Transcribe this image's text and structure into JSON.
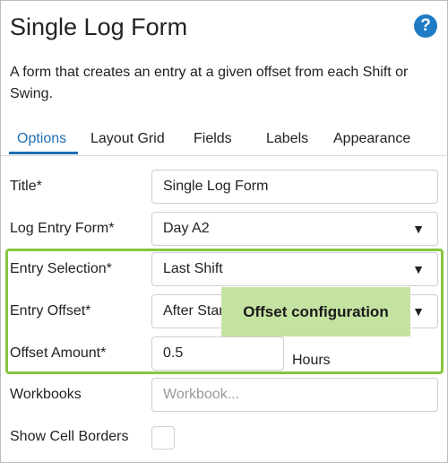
{
  "header": {
    "title": "Single Log Form",
    "help_icon": "?",
    "description": "A form that creates an entry at a given offset from each Shift or Swing."
  },
  "tabs": [
    {
      "label": "Options",
      "active": true
    },
    {
      "label": "Layout Grid",
      "active": false
    },
    {
      "label": "Fields",
      "active": false
    },
    {
      "label": "Labels",
      "active": false
    },
    {
      "label": "Appearance",
      "active": false
    }
  ],
  "form": {
    "title": {
      "label": "Title*",
      "value": "Single Log Form"
    },
    "log_entry_form": {
      "label": "Log Entry Form*",
      "value": "Day A2"
    },
    "entry_selection": {
      "label": "Entry Selection*",
      "value": "Last Shift"
    },
    "entry_offset": {
      "label": "Entry Offset*",
      "value": "After Start"
    },
    "offset_amount": {
      "label": "Offset Amount*",
      "value": "0.5",
      "unit": "Hours"
    },
    "workbooks": {
      "label": "Workbooks",
      "placeholder": "Workbook..."
    },
    "show_cell_borders": {
      "label": "Show Cell Borders",
      "checked": false
    }
  },
  "callout": {
    "text": "Offset configuration"
  },
  "icons": {
    "dropdown_caret": "▼"
  },
  "colors": {
    "accent_blue": "#1e6fb5",
    "help_blue": "#1e7bc4",
    "highlight_green": "#86c541",
    "callout_green": "#c4e3a1"
  }
}
